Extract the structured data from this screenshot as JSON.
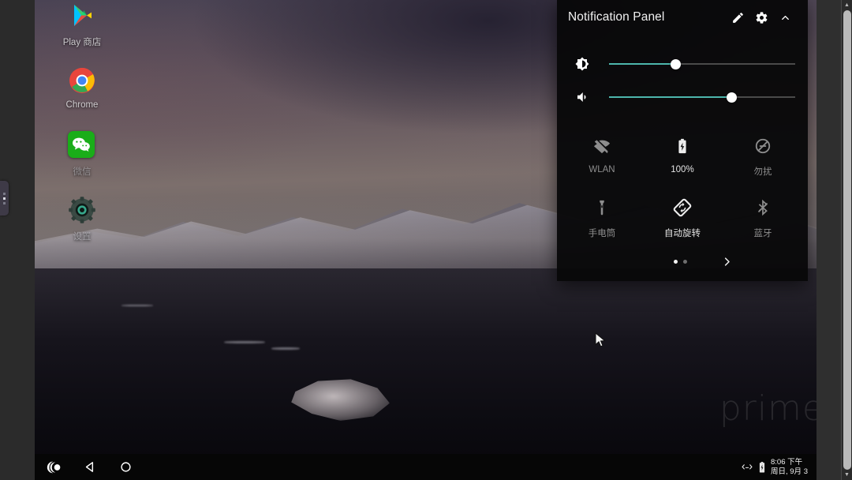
{
  "os": {
    "watermark": "prime"
  },
  "desktop": {
    "apps": [
      {
        "label": "Play 商店",
        "icon": "play-store-icon",
        "dim": false
      },
      {
        "label": "Chrome",
        "icon": "chrome-icon",
        "dim": false
      },
      {
        "label": "微信",
        "icon": "wechat-icon",
        "dim": true
      },
      {
        "label": "设置",
        "icon": "settings-icon",
        "dim": true
      }
    ]
  },
  "edge_tab": {
    "name": "edge-handle"
  },
  "notification_panel": {
    "title": "Notification Panel",
    "header_actions": [
      {
        "name": "edit-button",
        "icon": "pencil-icon"
      },
      {
        "name": "settings-button",
        "icon": "gear-icon"
      },
      {
        "name": "collapse-button",
        "icon": "chevron-up-icon"
      }
    ],
    "sliders": [
      {
        "name": "brightness",
        "icon": "brightness-icon",
        "value": 36
      },
      {
        "name": "volume",
        "icon": "volume-icon",
        "value": 66
      }
    ],
    "tiles": [
      {
        "label": "WLAN",
        "icon": "wifi-off-icon",
        "enabled": false
      },
      {
        "label": "100%",
        "icon": "battery-charging-icon",
        "enabled": true
      },
      {
        "label": "勿扰",
        "icon": "do-not-disturb-off-icon",
        "enabled": false
      },
      {
        "label": "手电筒",
        "icon": "flashlight-icon",
        "enabled": false
      },
      {
        "label": "自动旋转",
        "icon": "auto-rotate-icon",
        "enabled": true
      },
      {
        "label": "蓝牙",
        "icon": "bluetooth-off-icon",
        "enabled": false
      }
    ],
    "pager": {
      "pages": 2,
      "active": 1,
      "next_icon": "chevron-right-icon"
    },
    "accent_color": "#4db6ac"
  },
  "navbar": {
    "buttons": [
      {
        "name": "assistant-button",
        "icon": "assistant-icon"
      },
      {
        "name": "back-button",
        "icon": "back-triangle-icon"
      },
      {
        "name": "home-button",
        "icon": "home-circle-icon"
      }
    ],
    "tray": {
      "network_icon": "ethernet-icon",
      "battery_icon": "battery-icon",
      "time": "8:06 下午",
      "date": "周日, 9月 3"
    }
  },
  "scrollbar": {
    "up_icon": "caret-up-icon",
    "down_icon": "caret-down-icon"
  }
}
